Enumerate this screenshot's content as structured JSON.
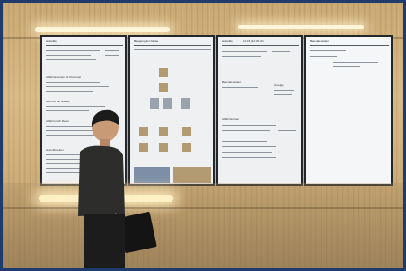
{
  "screens": [
    {
      "title": "Ankünfte",
      "sections": [
        "Abfahrtsmonitor für Personen",
        "Bahnhof mit Gleisen",
        "Abfahrt nach Zielen",
        "Ankunftszeiten"
      ]
    },
    {
      "title": "Belegung der Gleise",
      "sections": []
    },
    {
      "title": "Ankünfte",
      "time": "11:15 | 12:30 Uhr",
      "sections": [
        "Besonderheiten",
        "Anzeige",
        "Abfahrtszeiten"
      ]
    },
    {
      "title": "Besonderheiten",
      "sections": []
    }
  ],
  "colors": {
    "frame_border": "#1f3b6e",
    "wall": "#d8b984",
    "screen_bg": "#eef0f2",
    "bezel": "#23272c"
  }
}
